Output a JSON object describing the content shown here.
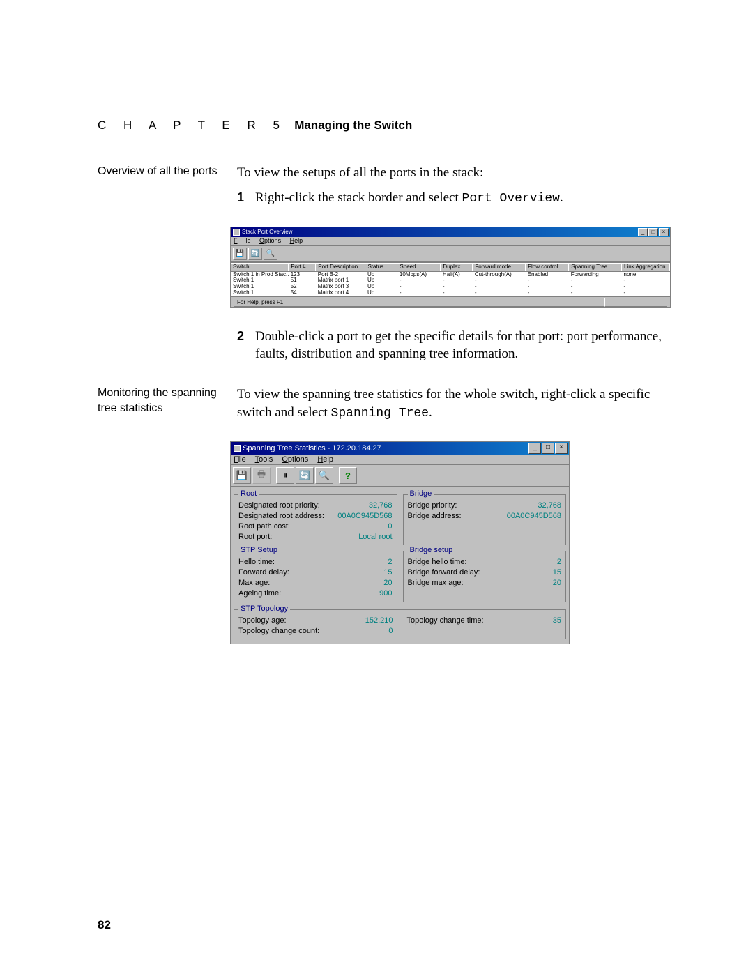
{
  "header": {
    "chapter_label": "C  H  A  P  T  E  R  5",
    "chapter_title": "Managing the Switch"
  },
  "sections": {
    "overview": {
      "margin_note": "Overview of all the ports",
      "intro": "To view the setups of all the ports in the stack:",
      "step1_num": "1",
      "step1_text_a": "Right-click the stack border and select ",
      "step1_text_b": "Port Overview",
      "step1_text_c": ".",
      "step2_num": "2",
      "step2_text": "Double-click a port to get the specific details for that port: port performance, faults, distribution and spanning tree information."
    },
    "spanning": {
      "margin_note": "Monitoring the spanning tree statistics",
      "intro_a": "To view the spanning tree statistics for the whole switch, right-click a specific switch and select ",
      "intro_b": "Spanning Tree",
      "intro_c": "."
    }
  },
  "shot1": {
    "title": "Stack Port Overview",
    "menu_file": "File",
    "menu_options": "Options",
    "menu_help": "Help",
    "columns": [
      "Switch",
      "Port #",
      "Port Description",
      "Status",
      "Speed",
      "Duplex",
      "Forward mode",
      "Flow control",
      "Spanning Tree",
      "Link Aggregation"
    ],
    "rows": [
      [
        "Switch 1 in Prod Stac..",
        "123",
        "Port B-2",
        "Up",
        "10Mbps(A)",
        "Half(A)",
        "Cut-through(A)",
        "Enabled",
        "Forwarding",
        "none"
      ],
      [
        "Switch 1",
        "51",
        "Matrix port 1",
        "Up",
        "-",
        "-",
        "-",
        "-",
        "-",
        "-"
      ],
      [
        "Switch 1",
        "52",
        "Matrix port 3",
        "Up",
        "-",
        "-",
        "-",
        "-",
        "-",
        "-"
      ],
      [
        "Switch 1",
        "54",
        "Matrix port 4",
        "Up",
        "-",
        "-",
        "-",
        "-",
        "-",
        "-"
      ]
    ],
    "status_text": "For Help, press F1"
  },
  "shot2": {
    "title": "Spanning Tree Statistics - 172.20.184.27",
    "menu_file": "File",
    "menu_tools": "Tools",
    "menu_options": "Options",
    "menu_help": "Help",
    "groups": {
      "root": {
        "legend": "Root",
        "items": [
          [
            "Designated root priority:",
            "32,768"
          ],
          [
            "Designated root address:",
            "00A0C945D568"
          ],
          [
            "Root path cost:",
            "0"
          ],
          [
            "Root port:",
            "Local root"
          ]
        ]
      },
      "bridge": {
        "legend": "Bridge",
        "items": [
          [
            "Bridge priority:",
            "32,768"
          ],
          [
            "Bridge address:",
            "00A0C945D568"
          ]
        ]
      },
      "stp_setup": {
        "legend": "STP Setup",
        "items": [
          [
            "Hello time:",
            "2"
          ],
          [
            "Forward delay:",
            "15"
          ],
          [
            "Max age:",
            "20"
          ],
          [
            "Ageing time:",
            "900"
          ]
        ]
      },
      "bridge_setup": {
        "legend": "Bridge setup",
        "items": [
          [
            "Bridge hello time:",
            "2"
          ],
          [
            "Bridge forward delay:",
            "15"
          ],
          [
            "Bridge max age:",
            "20"
          ]
        ]
      },
      "stp_topology": {
        "legend": "STP Topology",
        "left": [
          [
            "Topology age:",
            "152,210"
          ],
          [
            "Topology change count:",
            "0"
          ]
        ],
        "right": [
          [
            "Topology change time:",
            "35"
          ]
        ]
      }
    }
  },
  "page_number": "82"
}
